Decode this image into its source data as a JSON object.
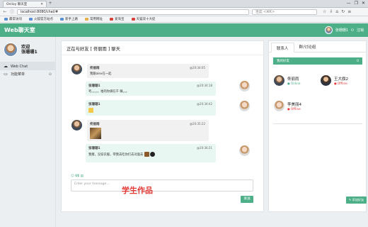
{
  "browser": {
    "tab_title": "Onlioy 聊天室",
    "new_tab": "+",
    "url": "localhost:8080/chat/#",
    "search_placeholder": "百度 <⌘K>",
    "window_controls": [
      "—",
      "❐",
      "✕"
    ],
    "bookmarks": [
      {
        "label": "最常访问",
        "icon": "star-icon"
      },
      {
        "label": "火狐官方站点",
        "icon": "firefox-icon"
      },
      {
        "label": "新手上路",
        "icon": "firefox-icon"
      },
      {
        "label": "常用网址",
        "icon": "folder-icon"
      },
      {
        "label": "爱淘宝",
        "icon": "taobao-icon"
      },
      {
        "label": "天猫双十大促",
        "icon": "tmall-icon"
      }
    ]
  },
  "header": {
    "brand": "Web聊天室",
    "menu_icon": "menu-icon",
    "username": "张珊珊1",
    "logout": "注销"
  },
  "sidebar": {
    "welcome": "欢迎",
    "username": "张珊珊1",
    "items": [
      {
        "label": "Web Chat",
        "icon": "chat-icon"
      },
      {
        "label": "功能菜单",
        "icon": "desktop-icon"
      }
    ]
  },
  "chat": {
    "title": "正在与好友 [ 佟丽雨 ] 聊天",
    "messages": [
      {
        "side": "left",
        "name": "佟丽雨",
        "time": "@20:34:05",
        "text": "我跟alex在一起"
      },
      {
        "side": "right",
        "name": "张珊珊1",
        "time": "@20:34:18",
        "text": "考。。。。。拍的你俩在干 嘛。。。"
      },
      {
        "side": "right",
        "name": "张珊珊1",
        "time": "@20:34:42",
        "text": ""
      },
      {
        "side": "left",
        "name": "佟丽雨",
        "time": "@20:35:22",
        "text": ""
      },
      {
        "side": "right",
        "name": "张珊珊1",
        "time": "@20:36:21",
        "text": "我擦，没穿衣服，带我去吃你们去对面去"
      }
    ],
    "input_tools": "☺ 𝗨𝗜 ▤",
    "input_placeholder": "Enter your message...",
    "send_label": "发送",
    "watermark": "学生作品"
  },
  "rightpanel": {
    "tabs": [
      "联系人",
      "群/讨论组"
    ],
    "group_label": "我的好友",
    "group_count": "0",
    "friends": [
      {
        "name": "佟丽雨",
        "status": "● Online"
      },
      {
        "name": "王大旗2",
        "status": "● Offline"
      },
      {
        "name": "李美丽4",
        "status": "● Offline"
      }
    ],
    "add_label": "✎ 添加好友"
  }
}
